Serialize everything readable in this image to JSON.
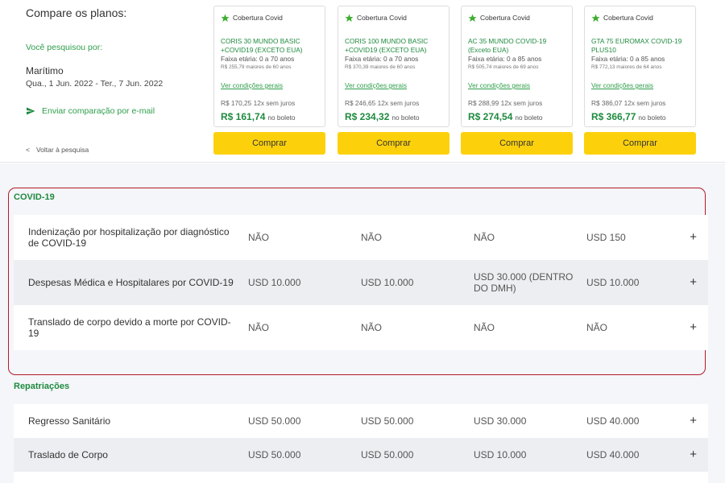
{
  "header": {
    "title": "Compare os planos:",
    "searched_label": "Você pesquisou por:",
    "destination": "Marítimo",
    "dates": "Qua., 1 Jun. 2022 - Ter., 7 Jun. 2022",
    "email_label": "Enviar comparação por e-mail",
    "back_label": "Voltar à pesquisa"
  },
  "plans": [
    {
      "badge": "Cobertura Covid",
      "name_line1": "CORIS 30 MUNDO BASIC",
      "name_line2": "+COVID19 (EXCETO EUA)",
      "age": "Faixa etária: 0 a 70 anos",
      "age_sub": "R$ 255,79 maiores de 60 anos",
      "conditions": "Ver condições gerais",
      "installment": "R$ 170,25 12x sem juros",
      "price": "R$ 161,74",
      "boleto": "no boleto",
      "buy": "Comprar"
    },
    {
      "badge": "Cobertura Covid",
      "name_line1": "CORIS 100 MUNDO BASIC",
      "name_line2": "+COVID19 (EXCETO EUA)",
      "age": "Faixa etária: 0 a 70 anos",
      "age_sub": "R$ 370,39 maiores de 60 anos",
      "conditions": "Ver condições gerais",
      "installment": "R$ 246,65 12x sem juros",
      "price": "R$ 234,32",
      "boleto": "no boleto",
      "buy": "Comprar"
    },
    {
      "badge": "Cobertura Covid",
      "name_line1": "AC 35 MUNDO COVID-19",
      "name_line2": "(Exceto EUA)",
      "age": "Faixa etária: 0 a 85 anos",
      "age_sub": "R$ 505,74 maiores de 69 anos",
      "conditions": "Ver condições gerais",
      "installment": "R$ 288,99 12x sem juros",
      "price": "R$ 274,54",
      "boleto": "no boleto",
      "buy": "Comprar"
    },
    {
      "badge": "Cobertura Covid",
      "name_line1": "GTA 75 EUROMAX COVID-19",
      "name_line2": "PLUS10",
      "age": "Faixa etária: 0 a 85 anos",
      "age_sub": "R$ 772,13 maiores de 64 anos",
      "conditions": "Ver condições gerais",
      "installment": "R$ 386,07 12x sem juros",
      "price": "R$ 366,77",
      "boleto": "no boleto",
      "buy": "Comprar"
    }
  ],
  "covid_section": {
    "title": "COVID-19",
    "rows": [
      {
        "label": "Indenização por hospitalização por diagnóstico de COVID-19",
        "values": [
          "NÃO",
          "NÃO",
          "NÃO",
          "USD 150"
        ],
        "expand": "+"
      },
      {
        "label": "Despesas Médica e Hospitalares por COVID-19",
        "values": [
          "USD 10.000",
          "USD 10.000",
          "USD 30.000 (DENTRO DO DMH)",
          "USD 10.000"
        ],
        "expand": "+"
      },
      {
        "label": "Translado de corpo devido a morte por COVID-19",
        "values": [
          "NÃO",
          "NÃO",
          "NÃO",
          "NÃO"
        ],
        "expand": "+"
      }
    ]
  },
  "repatriation_section": {
    "title": "Repatriações",
    "rows": [
      {
        "label": "Regresso Sanitário",
        "values": [
          "USD 50.000",
          "USD 50.000",
          "USD 30.000",
          "USD 40.000"
        ],
        "expand": "+"
      },
      {
        "label": "Traslado de Corpo",
        "values": [
          "USD 50.000",
          "USD 50.000",
          "USD 10.000",
          "USD 40.000"
        ],
        "expand": "+"
      }
    ]
  },
  "colors": {
    "accent_green": "#1f8a3f",
    "button_yellow": "#fcd10c",
    "highlight_red": "#b11a2a",
    "star_green": "#3cae2e"
  }
}
